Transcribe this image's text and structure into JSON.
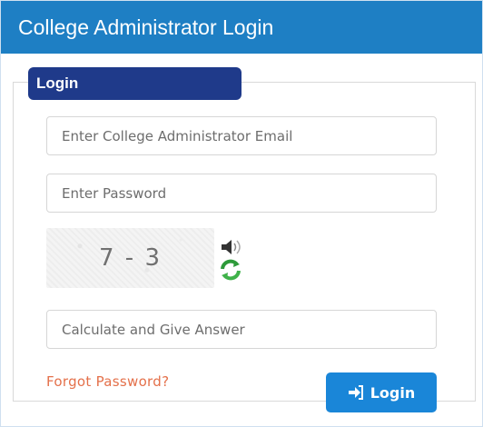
{
  "header": {
    "title": "College Administrator Login"
  },
  "form": {
    "legend": "Login",
    "email_placeholder": "Enter College Administrator Email",
    "password_placeholder": "Enter Password",
    "answer_placeholder": "Calculate and Give Answer",
    "captcha_text": "7 - 3",
    "forgot_label": "Forgot Password?",
    "login_label": "Login"
  },
  "colors": {
    "header_bg": "#1e7fc4",
    "legend_bg": "#1f3a8a",
    "button_bg": "#1a86d8",
    "forgot_link": "#e4704a"
  },
  "icons": {
    "audio": "speaker-icon",
    "refresh": "refresh-icon",
    "login": "sign-in-icon"
  }
}
